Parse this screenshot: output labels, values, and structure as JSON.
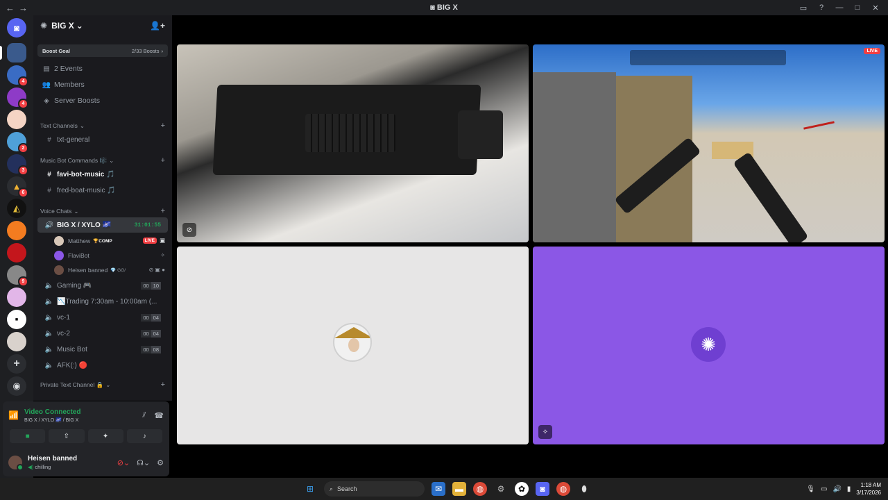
{
  "window": {
    "title": "BIG X",
    "nav_back": "←",
    "nav_fwd": "→"
  },
  "server": {
    "name": "BIG X",
    "chevron": "⌄",
    "boost_label": "Boost Goal",
    "boost_count": "2/33 Boosts",
    "boost_chevron": "›",
    "nav": [
      {
        "icon": "calendar-icon",
        "glyph": "▤",
        "label": "2 Events"
      },
      {
        "icon": "members-icon",
        "glyph": "👥",
        "label": "Members"
      },
      {
        "icon": "boost-icon",
        "glyph": "◈",
        "label": "Server Boosts"
      }
    ]
  },
  "categories": {
    "text": "Text Channels",
    "music": "Music Bot Commands 🎼",
    "voice": "Voice Chats",
    "private": "Private Text Channel 🔒"
  },
  "channels": {
    "txt_general": "txt-general",
    "favi": "favi-bot-music 🎵",
    "fred": "fred-boat-music 🎵",
    "bigx": "BIG X / XYLO 🌌",
    "bigx_timer": "31:01:55",
    "gaming": "Gaming 🎮",
    "gaming_a": "00",
    "gaming_b": "10",
    "trading": "📉Trading 7:30am - 10:00am (...",
    "vc1": "vc-1",
    "vc1_a": "00",
    "vc1_b": "04",
    "vc2": "vc-2",
    "vc2_a": "00",
    "vc2_b": "04",
    "musicbot": "Music Bot",
    "musicbot_a": "00",
    "musicbot_b": "08",
    "afk": "AFK(:) 🔴"
  },
  "members": [
    {
      "name": "Matthew",
      "tag": "🏆COMP",
      "live": "LIVE",
      "color": "#d8c7b8"
    },
    {
      "name": "FlaviBot",
      "tag": "",
      "live": "",
      "color": "#8b57e6"
    },
    {
      "name": "Heisen banned",
      "tag": "💎 GG/",
      "live": "",
      "color": "#6b4e44"
    }
  ],
  "voice_panel": {
    "status": "Video Connected",
    "location": "BIG X / XYLO 🌌 / BIG X",
    "user_name": "Heisen banned",
    "user_status": "chilling"
  },
  "tiles": {
    "live_label": "LIVE"
  },
  "taskbar": {
    "search_placeholder": "Search",
    "time": "1:18 AM",
    "date": "3/17/2026"
  },
  "colors": {
    "accent_green": "#23a55a",
    "live_red": "#f23f43",
    "flavibot_purple": "#8b57e6"
  }
}
